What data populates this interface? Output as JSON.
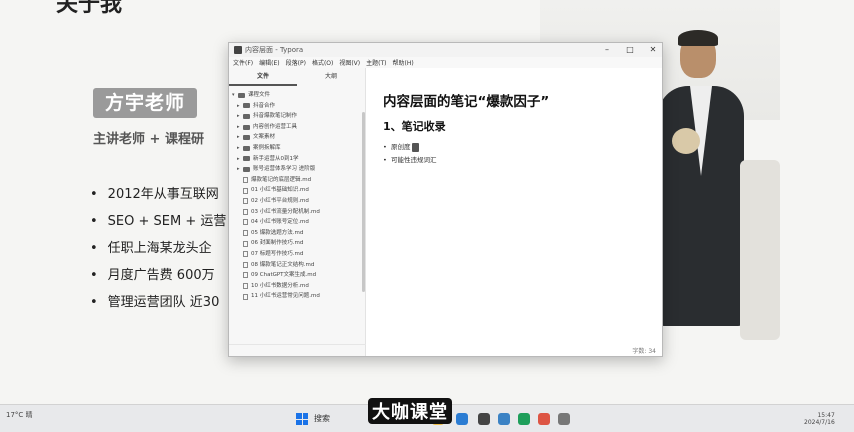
{
  "slide": {
    "title": "关于我",
    "name": "方宇老师",
    "role": "主讲老师 + 课程研",
    "bullets": [
      "2012年从事互联网",
      "SEO + SEM + 运营",
      "任职上海某龙头企",
      "月度广告费 600万",
      "管理运营团队 近30"
    ]
  },
  "window": {
    "title": "内容层面 - Typora",
    "menu": [
      "文件(F)",
      "编辑(E)",
      "段落(P)",
      "格式(O)",
      "视图(V)",
      "主题(T)",
      "帮助(H)"
    ],
    "sidebar_tabs": [
      "文件",
      "大纲"
    ],
    "tree": [
      {
        "type": "folder",
        "open": true,
        "label": "课程文件"
      },
      {
        "type": "folder",
        "label": "抖音合作"
      },
      {
        "type": "folder",
        "label": "抖音爆款笔记制作"
      },
      {
        "type": "folder",
        "label": "内容创作运营工具"
      },
      {
        "type": "folder",
        "label": "文案素材"
      },
      {
        "type": "folder",
        "label": "案例拆解库"
      },
      {
        "type": "folder",
        "label": "新手运营从0到1学"
      },
      {
        "type": "folder",
        "label": "账号运营体系学习 进阶版"
      },
      {
        "type": "file",
        "label": "爆款笔记的底层逻辑.md"
      },
      {
        "type": "file",
        "label": "01 小红书基础知识.md"
      },
      {
        "type": "file",
        "label": "02 小红书平台规则.md"
      },
      {
        "type": "file",
        "label": "03 小红书流量分配机制.md"
      },
      {
        "type": "file",
        "label": "04 小红书账号定位.md"
      },
      {
        "type": "file",
        "label": "05 爆款选题方法.md"
      },
      {
        "type": "file",
        "label": "06 封面制作技巧.md"
      },
      {
        "type": "file",
        "label": "07 标题写作技巧.md"
      },
      {
        "type": "file",
        "label": "08 爆款笔记正文结构.md"
      },
      {
        "type": "file",
        "label": "09 ChatGPT文案生成.md"
      },
      {
        "type": "file",
        "label": "10 小红书数据分析.md"
      },
      {
        "type": "file",
        "label": "11 小红书运营常见问题.md"
      }
    ],
    "doc": {
      "h1": "内容层面的笔记“爆款因子”",
      "h2": "1、笔记收录",
      "items": [
        "原创度",
        "可能性违规词汇"
      ]
    },
    "status": "字数: 34"
  },
  "taskbar": {
    "weather": "17°C 晴",
    "search": "搜索",
    "watermark": "大咖课堂",
    "time": "15:47",
    "date": "2024/7/16"
  }
}
